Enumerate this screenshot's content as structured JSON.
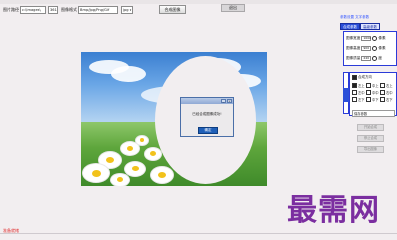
{
  "toolbar": {
    "field1_label": "图片路径",
    "field1_value": "c:\\Images\\",
    "field2_value": "361",
    "field3_label": "图像格式",
    "field3_value": "Bmp/Jpg/Png/Gif",
    "field4_value": "jpg",
    "button_label": "合成图像",
    "close_label": "退出"
  },
  "dialog": {
    "title": "",
    "message": "已经合成图像成功!",
    "ok_label": "确定"
  },
  "right_panel": {
    "top_title": "参数设置 文字参数",
    "tabs": [
      "合成参数",
      "高级参数"
    ],
    "rows": [
      {
        "label": "图像宽度",
        "value": "1600",
        "unit": "像素"
      },
      {
        "label": "图像高度",
        "value": "900",
        "unit": "像素"
      },
      {
        "label": "图像质量",
        "value": "240",
        "unit": "度"
      }
    ],
    "checkbox_title": "合成方向",
    "checkboxes": [
      "左上",
      "中上",
      "右上",
      "左中",
      "中中",
      "右中",
      "左下",
      "中下",
      "右下"
    ],
    "checkbox_footer": "保存参数",
    "buttons": [
      "开始合成",
      "停止合成",
      "导出图像"
    ]
  },
  "status": {
    "text": "准备就绪"
  },
  "watermark": "最需网"
}
